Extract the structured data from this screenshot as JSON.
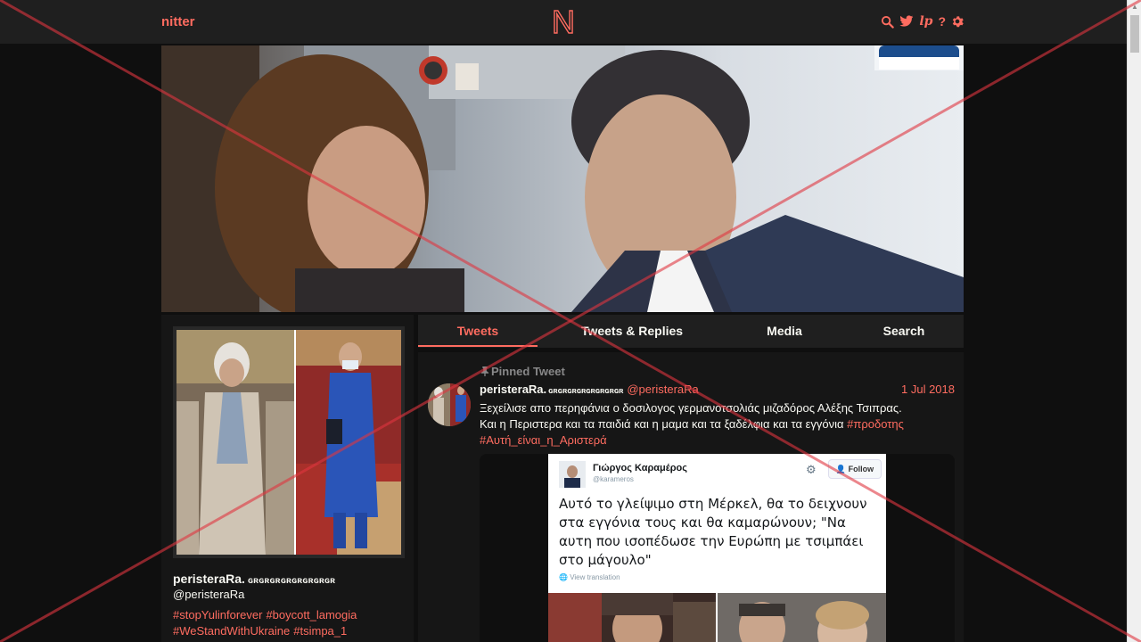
{
  "nav": {
    "brand": "nitter",
    "logo_letter": "N",
    "icons": [
      "search-icon",
      "twitter-icon",
      "liberapay-icon",
      "help-icon",
      "gear-icon"
    ],
    "icon_glyphs": {
      "search": "🔍",
      "twitter": "🐦",
      "liberapay": "lp",
      "help": "?",
      "settings": "⚙"
    }
  },
  "profile": {
    "fullname": "peristeraRa.",
    "fullname_deco": "ɢʀɢʀɢʀɢʀɢʀɢʀɢʀɢʀ",
    "username": "@peristeraRa",
    "bio_tags": [
      "#stopYulinforever",
      "#boycott_lamogia",
      "#WeStandWithUkraine",
      "#tsimpa_1"
    ]
  },
  "tabs": [
    {
      "label": "Tweets",
      "active": true
    },
    {
      "label": "Tweets & Replies",
      "active": false
    },
    {
      "label": "Media",
      "active": false
    },
    {
      "label": "Search",
      "active": false
    }
  ],
  "tweet": {
    "pinned_label": "Pinned Tweet",
    "fullname": "peristeraRa.",
    "fullname_deco": "ɢʀɢʀɢʀɢʀɢʀɢʀɢʀɢʀ",
    "username": "@peristeraRa",
    "date": "1 Jul 2018",
    "text_line1": "Ξεχείλισε απο περηφάνια ο δοσιλογος γερμανοτσολιάς μιζαδόρος Αλέξης Τσιπρας.",
    "text_line2": "Και η Περιστερα και τα παιδιά και η μαμα και τα ξαδέλφια και τα εγγόνια ",
    "tag1": "#προδοτης",
    "tag2": "#Αυτή_είναι_η_Αριστερά",
    "embed": {
      "name": "Γιώργος Καραμέρος",
      "handle": "@karameros",
      "follow_label": "Follow",
      "text": "Αυτό το γλείψιμο στη Μέρκελ, θα το δειχνουν στα εγγόνια τους και θα καμαρώνουν; \"Να αυτη που ισοπέδωσε την Ευρώπη με τσιμπάει στο μάγουλο\"",
      "translate_label": "View translation"
    }
  },
  "colors": {
    "accent": "#ff6c60",
    "background": "#0f0f0f",
    "panel": "#161616",
    "navbar": "#1f1f1f",
    "overlay_cross": "#e0353f"
  }
}
